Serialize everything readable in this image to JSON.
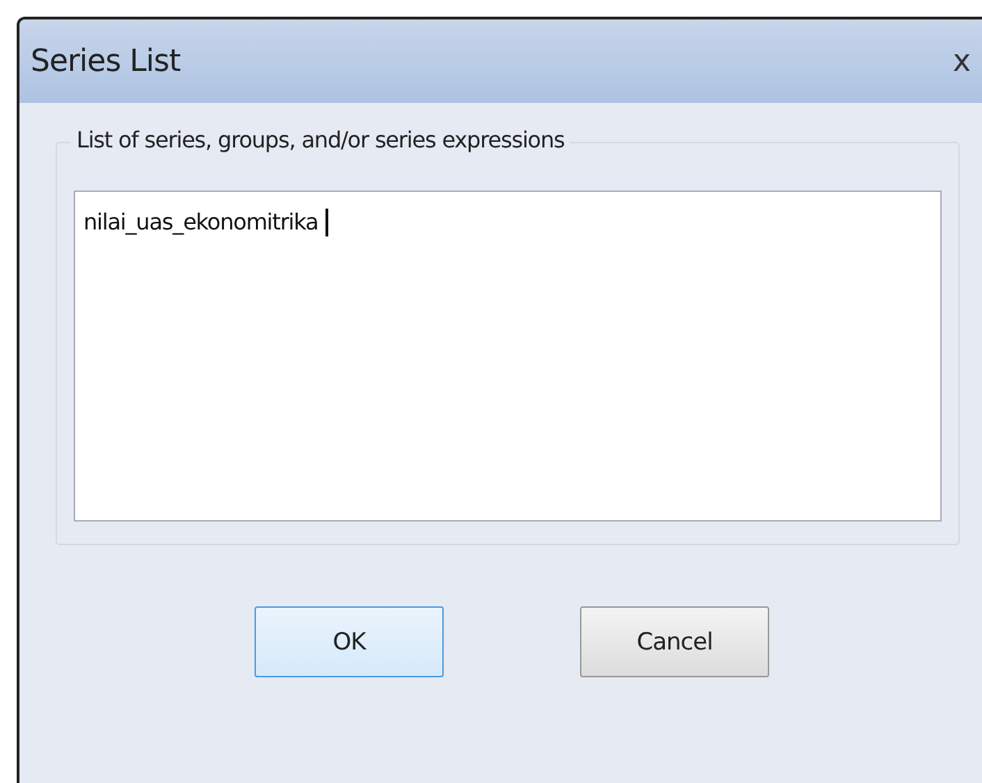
{
  "window": {
    "title": "Series List",
    "close": "x"
  },
  "group": {
    "label": "List of series, groups, and/or series expressions",
    "value": "nilai_uas_ekonomitrika "
  },
  "buttons": [
    {
      "label": "OK",
      "default": true
    },
    {
      "label": "Cancel",
      "default": false
    }
  ]
}
